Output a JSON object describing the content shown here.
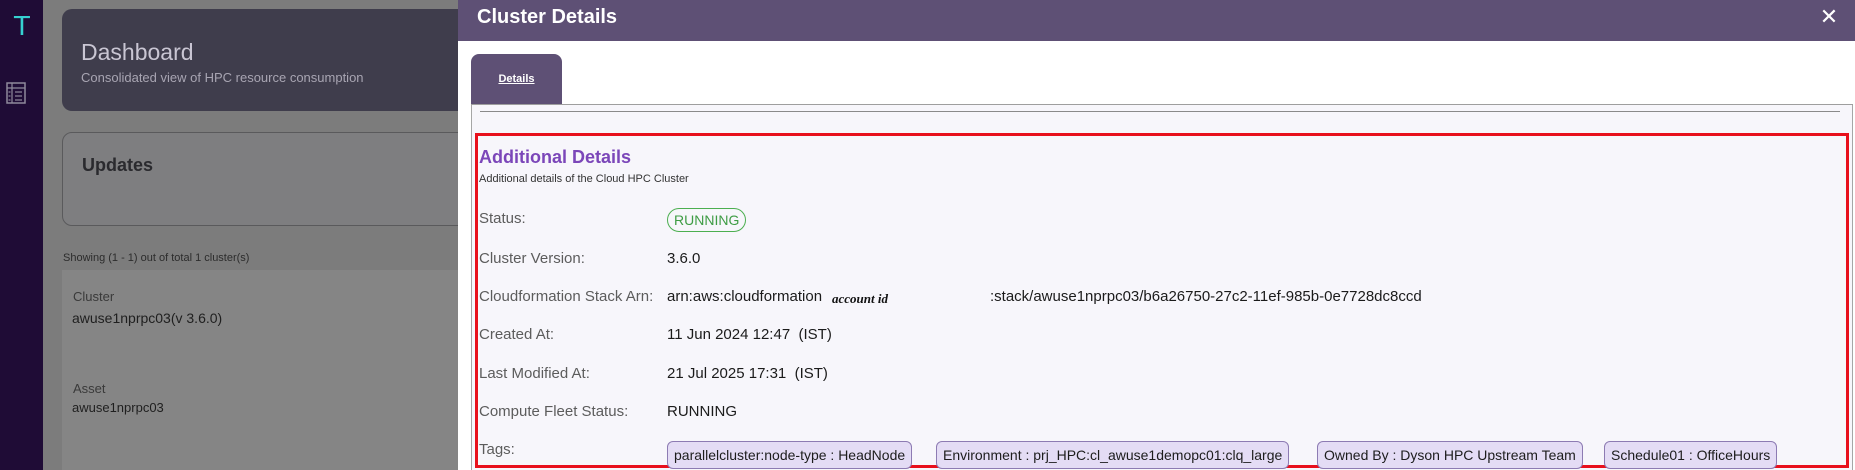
{
  "rail": {
    "logo_letter": "T",
    "nav_icon": "table-icon"
  },
  "background": {
    "dashboard_title": "Dashboard",
    "dashboard_subtitle": "Consolidated view of HPC resource consumption",
    "updates_title": "Updates",
    "showing_text": "Showing (1 - 1) out of total 1 cluster(s)",
    "cluster_label": "Cluster",
    "cluster_value": "awuse1nprpc03(v 3.6.0)",
    "asset_label": "Asset",
    "asset_value": "awuse1nprpc03"
  },
  "drawer": {
    "title": "Cluster Details",
    "close_icon": "close-icon",
    "tabs": [
      {
        "label": "Details"
      }
    ],
    "section_title": "Additional Details",
    "section_subtitle": "Additional details of the Cloud HPC Cluster",
    "rows": {
      "status": {
        "label": "Status:",
        "value": "RUNNING"
      },
      "cluster_version": {
        "label": "Cluster Version:",
        "value": "3.6.0"
      },
      "stack_arn": {
        "label": "Cloudformation Stack Arn:",
        "value_prefix": "arn:aws:cloudformation",
        "redaction_note": "account id",
        "value_suffix": ":stack/awuse1nprpc03/b6a26750-27c2-11ef-985b-0e7728dc8ccd"
      },
      "created_at": {
        "label": "Created At:",
        "value": "11 Jun 2024 12:47  (IST)"
      },
      "last_modified_at": {
        "label": "Last Modified At:",
        "value": "21 Jul 2025 17:31  (IST)"
      },
      "compute_fleet_status": {
        "label": "Compute Fleet Status:",
        "value": "RUNNING"
      },
      "tags": {
        "label": "Tags:",
        "items": [
          "parallelcluster:node-type : HeadNode",
          "Environment : prj_HPC:cl_awuse1demopc01:clq_large",
          "Owned By : Dyson HPC Upstream Team",
          "Schedule01 : OfficeHours"
        ]
      }
    }
  },
  "colors": {
    "header": "#5e5075",
    "accent_title": "#7b46b9",
    "highlight_border": "#e8101c",
    "status_green": "#3e9c44",
    "tag_bg": "#e4dcf5"
  }
}
